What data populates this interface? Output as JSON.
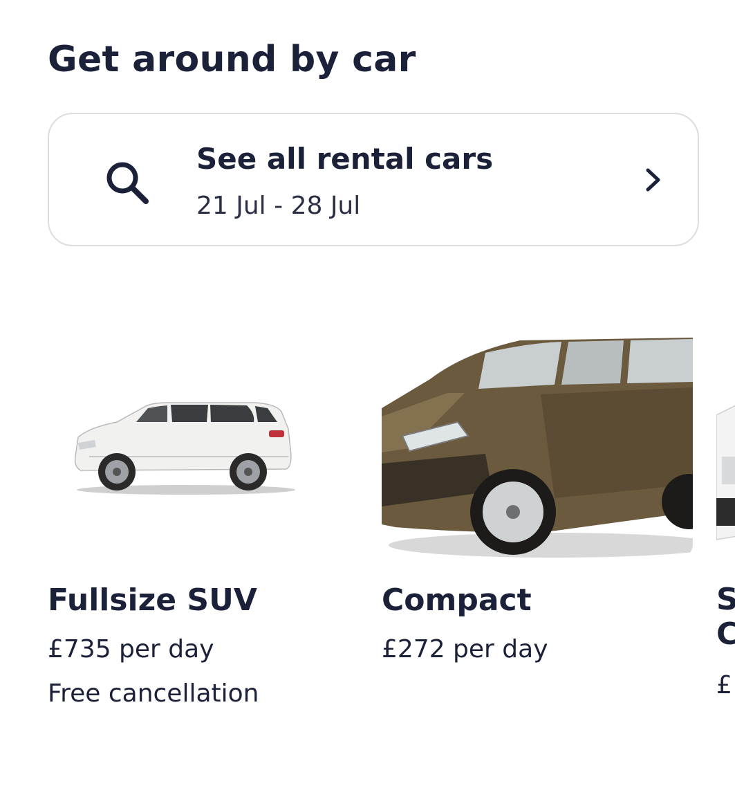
{
  "section": {
    "title": "Get around by car"
  },
  "search_card": {
    "title": "See all rental cars",
    "dates": "21 Jul - 28 Jul",
    "icon": "search-icon",
    "chevron": "chevron-right-icon"
  },
  "cars": [
    {
      "name": "Fullsize SUV",
      "price": "£735 per day",
      "extra": "Free cancellation",
      "body_color": "#f1f1ef"
    },
    {
      "name": "Compact",
      "price": "£272 per day",
      "extra": "",
      "body_color": "#6b5a3e"
    },
    {
      "name": "S",
      "name_line2": "C",
      "price": "£",
      "extra": "",
      "body_color": "#f3f3f3"
    }
  ],
  "colors": {
    "text": "#1b2138",
    "border": "#dcdde1"
  }
}
